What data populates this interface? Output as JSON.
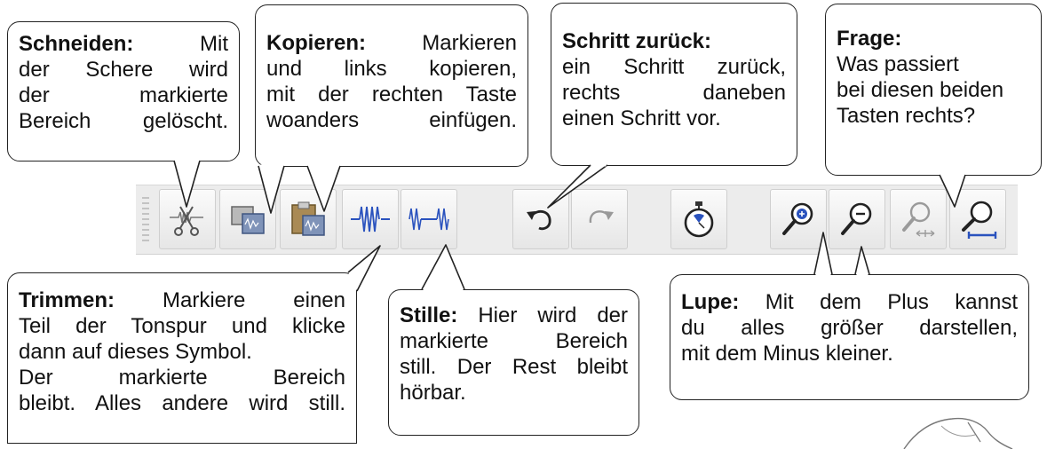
{
  "callouts": {
    "schneiden": {
      "title": "Schneiden:",
      "l1": "Mit",
      "l2": "der Schere wird",
      "l3": "der markierte",
      "l4": "Bereich gelöscht."
    },
    "kopieren": {
      "title": "Kopieren:",
      "l1": "Markieren",
      "l2": "und links kopieren,",
      "l3": "mit der rechten Taste",
      "l4": "woanders einfügen."
    },
    "schritt": {
      "title": "Schritt zurück:",
      "l1": "ein Schritt zurück,",
      "l2": "rechts daneben",
      "l3": "einen Schritt vor."
    },
    "frage": {
      "title": "Frage:",
      "l1": "Was passiert",
      "l2": "bei diesen beiden",
      "l3": "Tasten rechts?"
    },
    "trimmen": {
      "title": "Trimmen:",
      "l1": "Markiere einen",
      "l2": "Teil der Tonspur und klicke",
      "l3": "dann auf dieses Symbol.",
      "l4": "Der markierte Bereich",
      "l5": "bleibt. Alles andere wird still."
    },
    "stille": {
      "title": "Stille:",
      "l1": "Hier wird der",
      "l2": "markierte Bereich",
      "l3": "still. Der Rest bleibt",
      "l4": "hörbar."
    },
    "lupe": {
      "title": "Lupe:",
      "l1": "Mit dem Plus kannst",
      "l2": "du alles größer darstellen,",
      "l3": "mit dem Minus kleiner."
    }
  },
  "toolbar": {
    "buttons": [
      {
        "icon": "scissors-icon"
      },
      {
        "icon": "copy-icon"
      },
      {
        "icon": "paste-icon"
      },
      {
        "icon": "trim-icon"
      },
      {
        "icon": "silence-icon"
      },
      {
        "icon": "undo-icon"
      },
      {
        "icon": "redo-icon"
      },
      {
        "icon": "timer-icon"
      },
      {
        "icon": "zoom-in-icon"
      },
      {
        "icon": "zoom-out-icon"
      },
      {
        "icon": "fit-selection-icon"
      },
      {
        "icon": "fit-project-icon"
      }
    ]
  },
  "colors": {
    "accent_blue": "#2a52be",
    "icon_gray": "#555555"
  }
}
